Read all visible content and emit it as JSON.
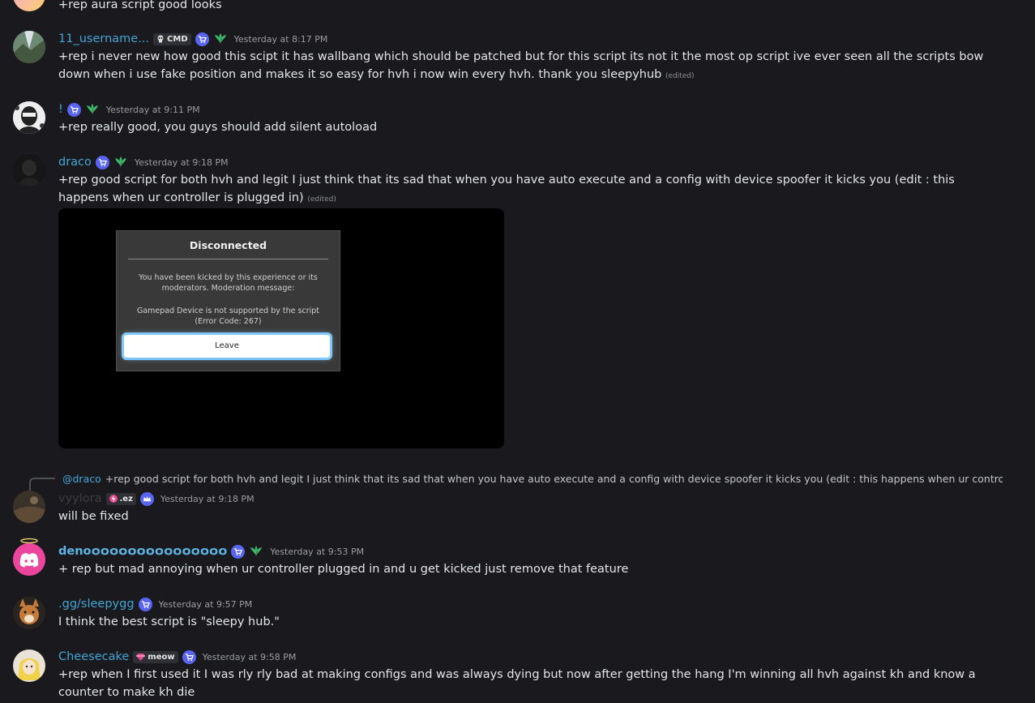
{
  "messages": [
    {
      "text": "+rep aura script good looks"
    },
    {
      "username": "11_username...",
      "tag": "CMD",
      "timestamp": "Yesterday at 8:17 PM",
      "text": "+rep i never new how good this scipt it has wallbang which should be patched but for this script its not it the most op script ive ever seen all the scripts bow down when i use fake position and makes it so easy for hvh i now win every hvh. thank you sleepyhub",
      "edited": "(edited)"
    },
    {
      "username": "!",
      "timestamp": "Yesterday at 9:11 PM",
      "text": "+rep really good, you guys should add silent autoload"
    },
    {
      "username": "draco",
      "timestamp": "Yesterday at 9:18 PM",
      "text": "+rep good script for both hvh and legit I just think that its sad that when you have auto execute and a config with device spoofer it kicks you (edit : this happens when ur controller is plugged in)",
      "edited": "(edited)",
      "attachment": {
        "title": "Disconnected",
        "line1": "You have been kicked by this experience or its",
        "line2": "moderators. Moderation message:",
        "line3": "Gamepad Device is not supported by the script",
        "line4": "(Error Code: 267)",
        "button": "Leave"
      }
    },
    {
      "reply_to": "@draco",
      "reply_preview": "+rep good script for both hvh and legit I just think that its sad that when you have auto execute and a config with device spoofer it kicks you (edit : this happens when ur controller i...",
      "username": "vyylora",
      "tag": ".ez",
      "timestamp": "Yesterday at 9:18 PM",
      "text": "will be fixed"
    },
    {
      "username": "deno໐໐໐໐໐໐໐໐໐໐໐໐໐໐໐",
      "timestamp": "Yesterday at 9:53 PM",
      "text": "+ rep but mad annoying when ur controller plugged in and u get kicked just remove that feature"
    },
    {
      "username": ".gg/sleepygg",
      "timestamp": "Yesterday at 9:57 PM",
      "text": "I think the best script is \"sleepy hub.\""
    },
    {
      "username": "Cheesecake",
      "tag": "meow",
      "timestamp": "Yesterday at 9:58 PM",
      "text": "+rep when I first used it I was rly rly bad at making configs and was always dying but now after getting the hang I'm winning all hvh against kh and know a counter to make kh die"
    }
  ],
  "colors": {
    "background": "#1a1a1e",
    "username": "#43a5d5",
    "badge": "#5865f2",
    "leaf": "#3fb96b"
  },
  "icons": [
    "shop-badge-icon",
    "leaf-badge-icon",
    "skull-tag-icon",
    "bolt-tag-icon",
    "gem-tag-icon",
    "image-icon",
    "discord-logo-icon"
  ]
}
